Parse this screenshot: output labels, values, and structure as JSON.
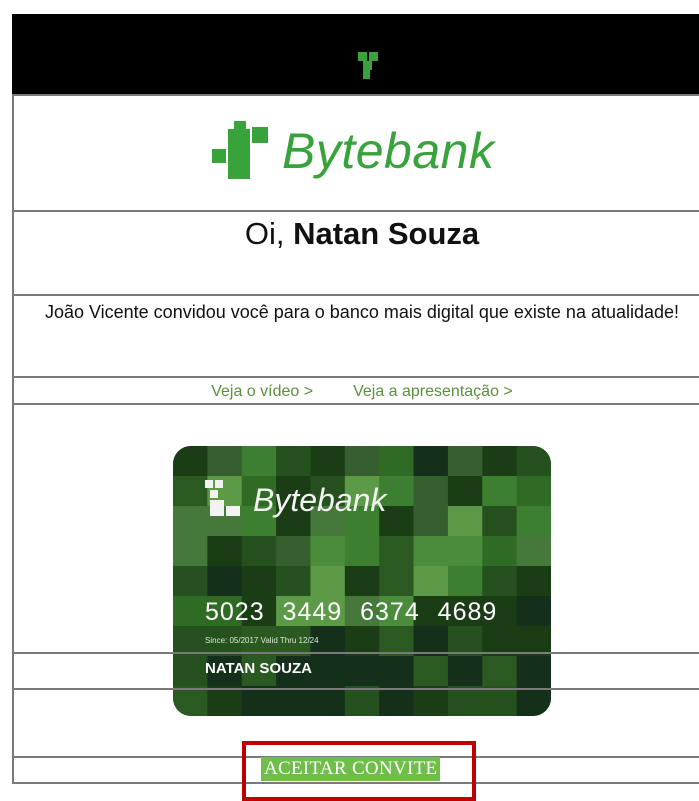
{
  "header": {
    "logo_icon": "bytebank-logo-icon"
  },
  "brand": {
    "name": "Bytebank",
    "icon": "bytebank-logo-icon",
    "color": "#37a33a"
  },
  "greeting": {
    "prefix": "Oi,",
    "name": "Natan Souza"
  },
  "invite": {
    "text": "João Vicente convidou você para o banco mais digital que existe na atualidade!"
  },
  "links": {
    "video": "Veja o vídeo >",
    "presentation": "Veja a apresentação >",
    "color": "#5a8f3c"
  },
  "card": {
    "brand": "Bytebank",
    "number": "5023 3449 6374 4689",
    "since": "Since: 05/2017  Valid Thru 12/24",
    "holder": "NATAN SOUZA"
  },
  "cta": {
    "label": "ACEITAR CONVITE",
    "color": "#6fbe4a",
    "highlight_color": "#c00000"
  }
}
